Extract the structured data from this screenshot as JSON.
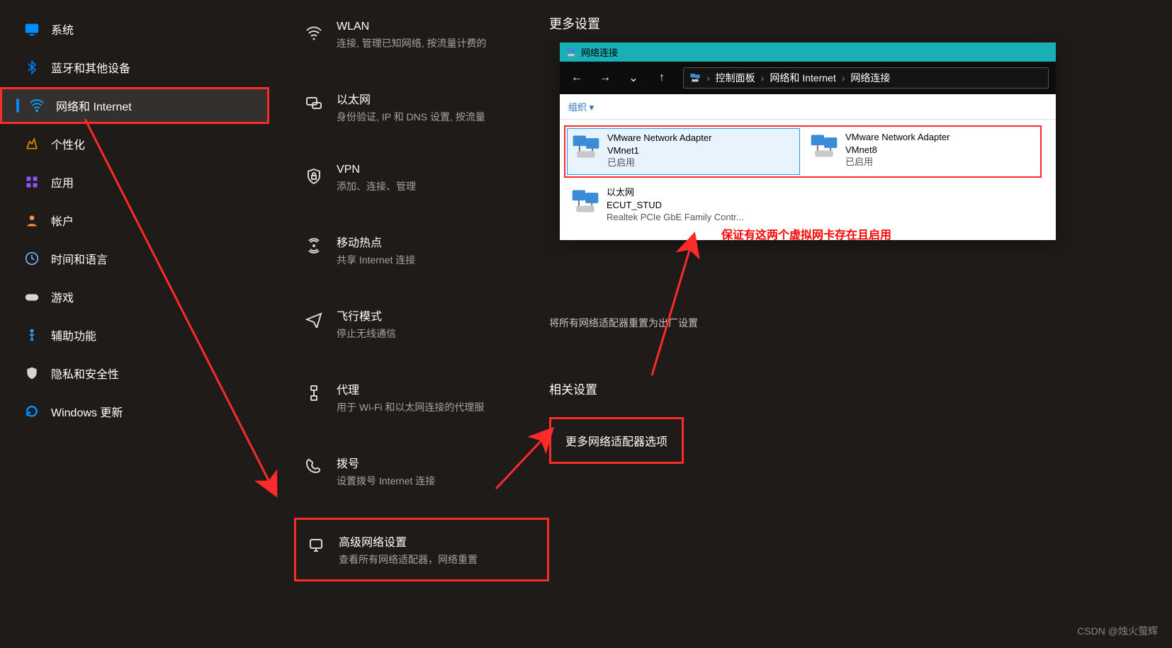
{
  "sidebar": {
    "items": [
      {
        "label": "系统",
        "icon": "system"
      },
      {
        "label": "蓝牙和其他设备",
        "icon": "bluetooth"
      },
      {
        "label": "网络和 Internet",
        "icon": "network"
      },
      {
        "label": "个性化",
        "icon": "personalize"
      },
      {
        "label": "应用",
        "icon": "apps"
      },
      {
        "label": "帐户",
        "icon": "accounts"
      },
      {
        "label": "时间和语言",
        "icon": "time"
      },
      {
        "label": "游戏",
        "icon": "gaming"
      },
      {
        "label": "辅助功能",
        "icon": "accessibility"
      },
      {
        "label": "隐私和安全性",
        "icon": "privacy"
      },
      {
        "label": "Windows 更新",
        "icon": "update"
      }
    ]
  },
  "mid": {
    "items": [
      {
        "title": "WLAN",
        "sub": "连接, 管理已知网络, 按流量计费的"
      },
      {
        "title": "以太网",
        "sub": "身份验证, IP 和 DNS 设置, 按流量"
      },
      {
        "title": "VPN",
        "sub": "添加、连接、管理"
      },
      {
        "title": "移动热点",
        "sub": "共享 Internet 连接"
      },
      {
        "title": "飞行模式",
        "sub": "停止无线通信"
      },
      {
        "title": "代理",
        "sub": "用于 Wi-Fi 和以太网连接的代理服"
      },
      {
        "title": "拨号",
        "sub": "设置拨号 Internet 连接"
      },
      {
        "title": "高级网络设置",
        "sub": "查看所有网络适配器，网络重置"
      }
    ]
  },
  "right": {
    "more_settings": "更多设置",
    "factory_text": "将所有网络适配器重置为出厂设置",
    "related": "相关设置",
    "more_adapter": "更多网络适配器选项"
  },
  "explorer": {
    "window_title": "网络连接",
    "back": "←",
    "forward": "→",
    "recent": "⌄",
    "up": "↑",
    "crumbs": [
      "控制面板",
      "网络和 Internet",
      "网络连接"
    ],
    "organize": "组织 ▾",
    "adapters": [
      {
        "name": "VMware Network Adapter",
        "sub1": "VMnet1",
        "sub2": "已启用"
      },
      {
        "name": "VMware Network Adapter",
        "sub1": "VMnet8",
        "sub2": "已启用"
      },
      {
        "name": "以太网",
        "sub1": "ECUT_STUD",
        "sub2": "Realtek PCIe GbE Family Contr..."
      }
    ]
  },
  "annotation": "保证有这两个虚拟网卡存在且启用",
  "watermark": "CSDN @烛火萤辉"
}
